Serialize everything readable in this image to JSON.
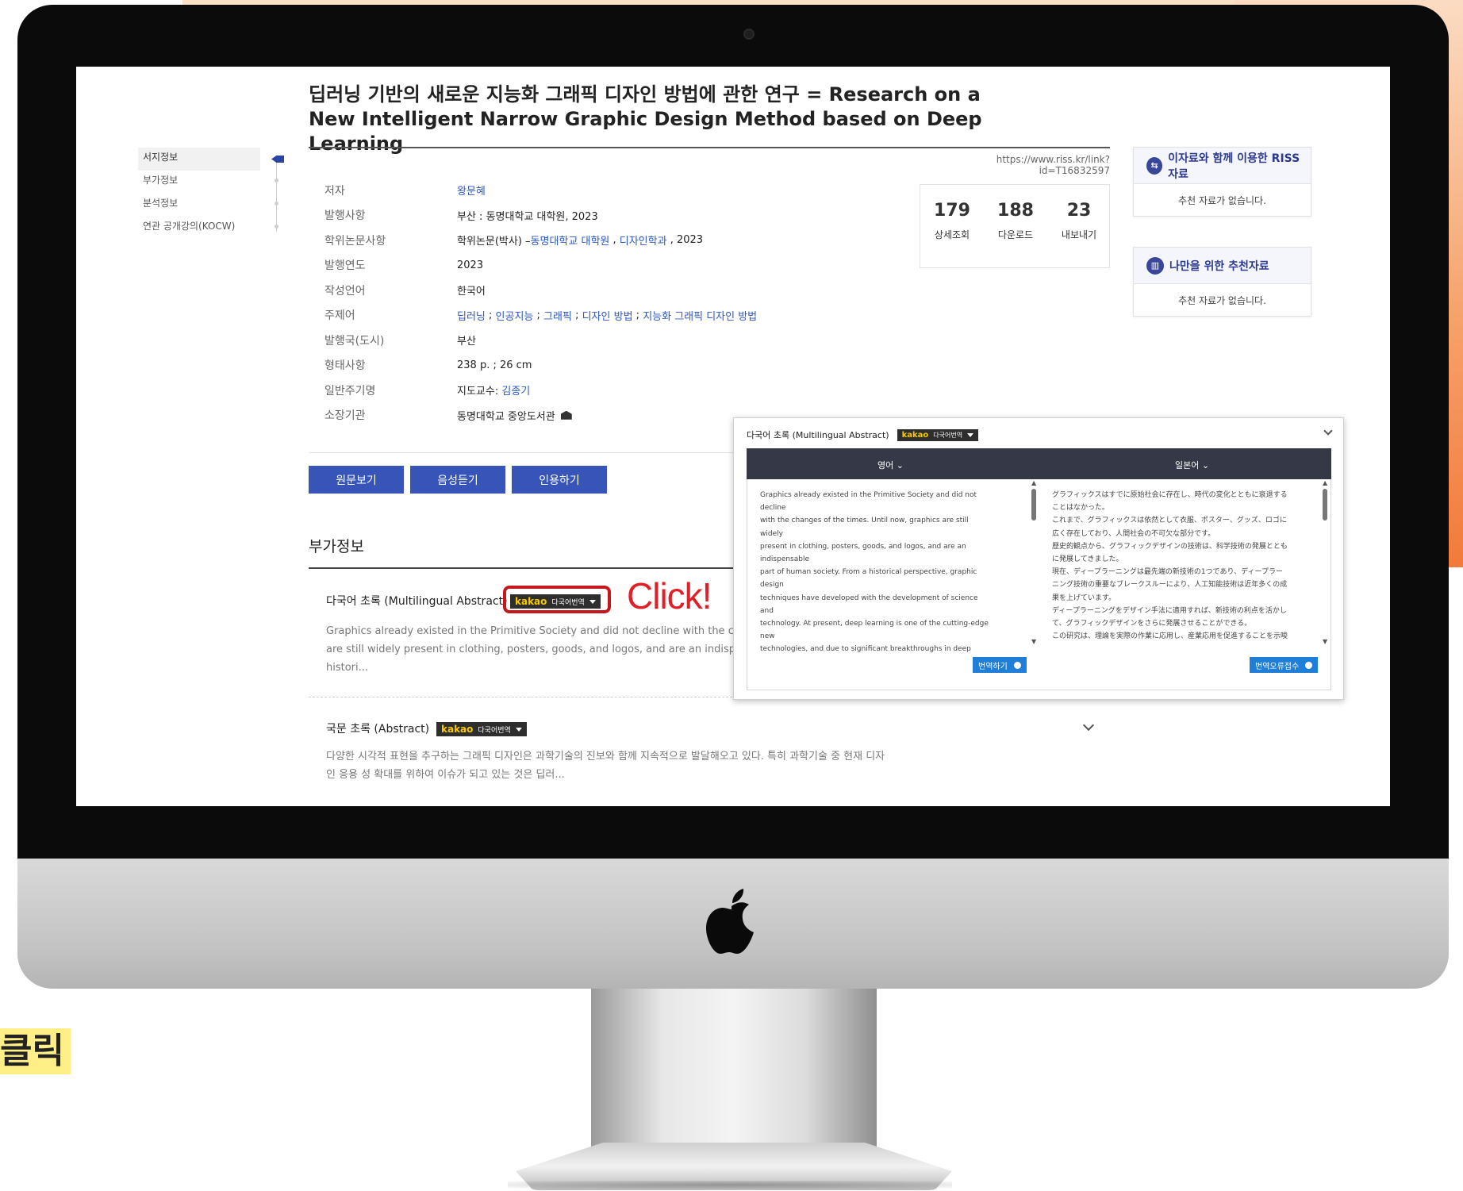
{
  "paper": {
    "title": "딥러닝 기반의 새로운 지능화 그래픽 디자인 방법에 관한 연구 = Research on a New Intelligent Narrow Graphic Design Method based on Deep Learning",
    "url": "https://www.riss.kr/link?id=T16832597"
  },
  "sidebar": {
    "items": [
      {
        "label": "서지정보"
      },
      {
        "label": "부가정보"
      },
      {
        "label": "분석정보"
      },
      {
        "label": "연관 공개강의(KOCW)"
      }
    ]
  },
  "info": {
    "author_label": "저자",
    "author": "왕문혜",
    "publisher_label": "발행사항",
    "publisher": "부산 : 동명대학교 대학원, 2023",
    "thesis_label": "학위논문사항",
    "thesis_prefix": "학위논문(박사) – ",
    "thesis_univ": "동명대학교 대학원",
    "thesis_sep": " , ",
    "thesis_dept": "디자인학과",
    "thesis_year": " , 2023",
    "year_label": "발행연도",
    "year": "2023",
    "lang_label": "작성언어",
    "lang": "한국어",
    "subject_label": "주제어",
    "subjects": [
      "딥러닝",
      "인공지능",
      "그래픽",
      "디자인 방법",
      "지능화 그래픽 디자인 방법"
    ],
    "subject_sep": " ; ",
    "country_label": "발행국(도시)",
    "country": "부산",
    "format_label": "형태사항",
    "format": "238 p. ; 26 cm",
    "note_label": "일반주기명",
    "note_prefix": "지도교수: ",
    "note_advisor": "김종기",
    "library_label": "소장기관",
    "library": "동명대학교 중앙도서관"
  },
  "stats": [
    {
      "num": "179",
      "label": "상세조회"
    },
    {
      "num": "188",
      "label": "다운로드"
    },
    {
      "num": "23",
      "label": "내보내기"
    }
  ],
  "recommend": {
    "riss_title": "이자료와 함께 이용한 RISS 자료",
    "riss_empty": "추천 자료가 없습니다.",
    "mine_title": "나만을 위한 추천자료",
    "mine_empty": "추천 자료가 없습니다."
  },
  "buttons": {
    "view": "원문보기",
    "listen": "음성듣기",
    "cite": "인용하기"
  },
  "extra": {
    "section_title": "부가정보",
    "multi_label": "다국어 초록 (Multilingual Abstract)",
    "kakao_brand": "kakao",
    "kakao_label": "다국어번역",
    "click": "Click!",
    "multi_text": "Graphics already existed in the Primitive Society and did not decline with the changes of the times. Until now, graphics are still widely present in clothing, posters, goods, and logos, and are an indispensable part of human society. From a historical perspective, graphic design techniques have developed with the development of science and technology. From a historical perspective, graphic design techniques have developed with the development of science and technology. From a historical perspective, graphic design techniques have developed with the development of science and technology. From a historical perspective, graphic design techniques have developed with the development of science and technology. From a historical perspective, graphic design techniques have developed with the development of science and technology. From a historical perspective, graphic design techniques have developed with the development of science and technology. From a historical perspective, graphic design techniques have developed with the development of science and technology. From a historical perspective, graphic design techniques have developed with the development of science and technology. From a historical perspective, graphic design techniques have developed with the development of science and technology. From a historical perspective, graphic design techniques have developed with the development of science and technology. From a historical perspective, graphic design techniques have developed with the development of science and technology. From a historical perspective, graphic design techniques have developed with the development of science and technology. From a historical perspective, graphic design techniques have developed with the development of science and technology. From a historical perspective, graphic design techniques have developed with the development of science and technology. From a historical perspective, graphic design techniques have developed with the development of science and technology. From a historical perspective, graphic design techniques have developed with the development of science and technology. From a historical perspective, graphic design techniques have developed with the development of science and technology. From a historical perspective, graphic design techniques have developed with the development of science and technology. From a historical perspective, graphic design techniques have developed with the development of science and technology. From a historical perspective, graphic design techniques have developed with the development of science and technology. From a historical perspective, graphic design techniques have developed with the development of science and technology. From a historical perspective, graphic design techniques have developed with the development of science and technology. From a historical perspective, graphic design techniques have developed with the development of science and technology. From a historical perspective, graphic design techniques have developed with the development of science and technology. From a historical perspective, graphic design techniques have developed with the development of science and technology. From a historical perspective, graphic design techniques have developed with the development of science and technology. From a historical perspective, graphic design techniques have developed with the development of science and technology. From a historical perspective, graphic design techniques have developed with the development of science and technology. From a historical perspective, graphic design techniques have developed with the development of science and technology. From a historical perspective, graphic design techniques have developed with the development of science and technology. From a historical perspective, graphic design techniques have developed with the development of science and technology. From a historical perspective, graphic design techniques have developed with the development of science and technology.",
    "multi_line1": "Graphics already existed in the Primitive Society and did not decline with the changes",
    "multi_line2": "are still widely present in clothing, posters, goods, and logos, and are an indispensable",
    "multi_line3": "histori...",
    "kor_label": "국문 초록 (Abstract)",
    "kor_line1": "다양한 시각적 표현을 추구하는 그래픽 디자인은 과학기술의 진보와 함께 지속적으로 발달해오고 있다. 특히 과학기술 중 현재 디자",
    "kor_line2": "인 응용 성 확대를 위하여 이슈가 되고 있는 것은 딥러..."
  },
  "popup": {
    "title": "다국어 초록 (Multilingual Abstract)",
    "lang_left": "영어",
    "lang_right": "일본어",
    "text_en": "Graphics already existed in the Primitive Society and did not decline\nwith the changes of the times. Until now, graphics are still widely\npresent in clothing, posters, goods, and logos, and are an indispensable\npart of human society. From a historical perspective, graphic design\ntechniques have developed with the development of science and\ntechnology. At present, deep learning is one of the cutting-edge new\ntechnologies, and due to significant breakthroughs in deep learning\ntechnology, artificial intelligence technology has achieved numerous\nresults in recent years. If deep learning is applied to design methods,\nthe advantages of new technologies can be fully utilized to further\ndevelop graphic design. This study suggests applying theory to practical\nwork to promote industrial application. For this purpose, the following",
    "text_ja": "グラフィックスはすでに原始社会に存在し、時代の変化とともに衰退する\nことはなかった。\nこれまで、グラフィックスは依然として衣服、ポスター、グッズ、ロゴに\n広く存在しており、人間社会の不可欠な部分です。\n歴史的観点から、グラフィックデザインの技術は、科学技術の発展ととも\nに発展してきました。\n現在、ディープラーニングは最先端の新技術の1つであり、ディープラー\nニング技術の重要なブレークスルーにより、人工知能技術は近年多くの成\n果を上げています。\nディープラーニングをデザイン手法に適用すれば、新技術の利点を活かし\nて、グラフィックデザインをさらに発展させることができる。\nこの研究は、理論を実際の作業に応用し、産業応用を促進することを示唆",
    "btn_translate": "번역하기",
    "btn_report": "번역오류접수"
  },
  "overlay": {
    "click_kr": "클릭"
  }
}
